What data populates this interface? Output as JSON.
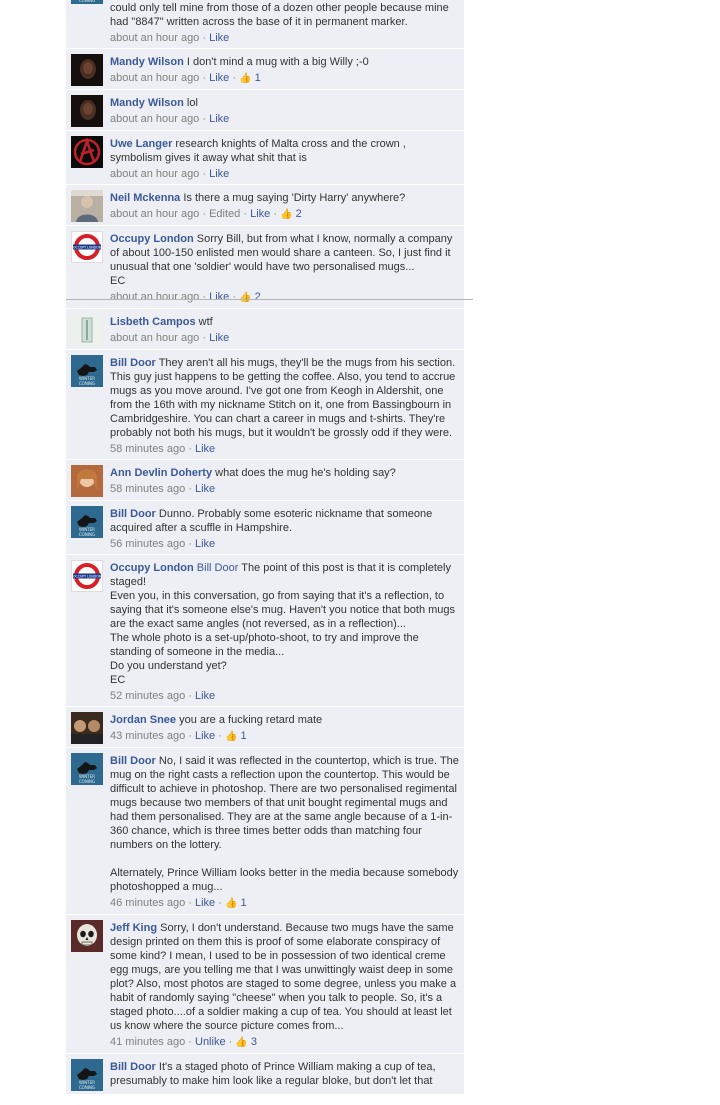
{
  "comments": [
    {
      "author": "",
      "text": "could only tell mine from those of a dozen other people because mine had \"8847\" written across the base of it in permanent marker.",
      "time": "about an hour ago",
      "like": "Like",
      "avatar": "bill"
    },
    {
      "author": "Mandy Wilson",
      "text": "I don't mind a mug with a big Willy ;-0",
      "time": "about an hour ago",
      "like": "Like",
      "likes": "1",
      "avatar": "mandy"
    },
    {
      "author": "Mandy Wilson",
      "text": "lol",
      "time": "about an hour ago",
      "like": "Like",
      "avatar": "mandy"
    },
    {
      "author": "Uwe Langer",
      "text": "research knights of Malta cross and the crown , symbolism gives it away what shit that is",
      "time": "about an hour ago",
      "like": "Like",
      "avatar": "uwe"
    },
    {
      "author": "Neil Mckenna",
      "text": "Is there a mug saying 'Dirty Harry' anywhere?",
      "time": "about an hour ago",
      "edited": "Edited",
      "like": "Like",
      "likes": "2",
      "avatar": "neil"
    },
    {
      "author": "Occupy London",
      "text": "Sorry Bill, but from what I know, normally a company of about 100-150 enlisted men would share a canteen. So, I just find it unusual that one 'soldier' would have two personalised mugs...\nEC",
      "time": "about an hour ago",
      "like": "Like",
      "likes": "2",
      "avatar": "occupy"
    },
    {
      "author": "Lisbeth Campos",
      "text": "wtf",
      "time": "about an hour ago",
      "like": "Like",
      "avatar": "lisbeth"
    },
    {
      "author": "Bill Door",
      "text": "They aren't all his mugs, they'll be the mugs from his section. This guy just happens to be getting the coffee. Also, you tend to accrue mugs as you move around. I've got one from Keogh in Aldershit, one from the 16th with my nickname Stitch on it, one from Bassingbourn in Cambridgeshire. You can chart a career in mugs and t-shirts. They're probably not both his mugs, but it wouldn't be grossly odd if they were.",
      "time": "58 minutes ago",
      "like": "Like",
      "avatar": "bill"
    },
    {
      "author": "Ann Devlin Doherty",
      "text": "what does the mug he's holding say?",
      "time": "58 minutes ago",
      "like": "Like",
      "avatar": "ann"
    },
    {
      "author": "Bill Door",
      "text": "Dunno. Probably some esoteric nickname that someone acquired after a scuffle in Hampshire.",
      "time": "56 minutes ago",
      "like": "Like",
      "avatar": "bill"
    },
    {
      "author": "Occupy London",
      "tag": "Bill Door",
      "text": "The point of this post is that it is completely staged!\nEven you, in this conversation, go from saying that it's a reflection, to saying that it's someone else's mug. Haven't you notice that both mugs are the exact same angles (not reversed, as in a reflection)...\nThe whole photo is a set-up/photo-shoot, to try and improve the standing of someone in the media...\nDo you understand yet?\nEC",
      "time": "52 minutes ago",
      "like": "Like",
      "avatar": "occupy"
    },
    {
      "author": "Jordan Snee",
      "text": "you are a fucking retard mate",
      "time": "43 minutes ago",
      "like": "Like",
      "likes": "1",
      "avatar": "jordan"
    },
    {
      "author": "Bill Door",
      "text": "No, I said it was reflected in the countertop, which is true. The mug on the right casts a reflection upon the countertop. This would be difficult to achieve in photoshop. There are two personalised regimental mugs because two members of that unit bought regimental mugs and had them personalised. They are at the same angle because of a 1-in-360 chance, which is three times better odds than matching four numbers on the lottery.\n\nAlternately, Prince William looks better in the media because somebody photoshopped a mug...",
      "time": "46 minutes ago",
      "like": "Like",
      "likes": "1",
      "avatar": "bill"
    },
    {
      "author": "Jeff King",
      "text": "Sorry, I don't understand. Because two mugs have the same design printed on them this is proof of some elaborate conspiracy of some kind? I mean, I used to be in possession of two identical creme egg mugs, are you telling me that I was unwittingly waist deep in some plot? Also, most photos are staged to some degree, unless you make a habit of randomly saying \"cheese\" when you talk to people. So, it's a staged photo....of a soldier making a cup of tea. You should at least let us know where the source picture comes from...",
      "time": "41 minutes ago",
      "like": "Unlike",
      "likes": "3",
      "avatar": "jeff"
    },
    {
      "author": "Bill Door",
      "text": "It's a staged photo of Prince William making a cup of tea, presumably to make him look like a regular bloke, but don't let that",
      "avatar": "bill"
    }
  ],
  "avatar_text": {
    "occupy": "OCCUPY LONDON",
    "bill": "WINTER CONING"
  },
  "colors": {
    "link": "#3b5998",
    "meta": "#808080",
    "panel": "#edeff4"
  }
}
